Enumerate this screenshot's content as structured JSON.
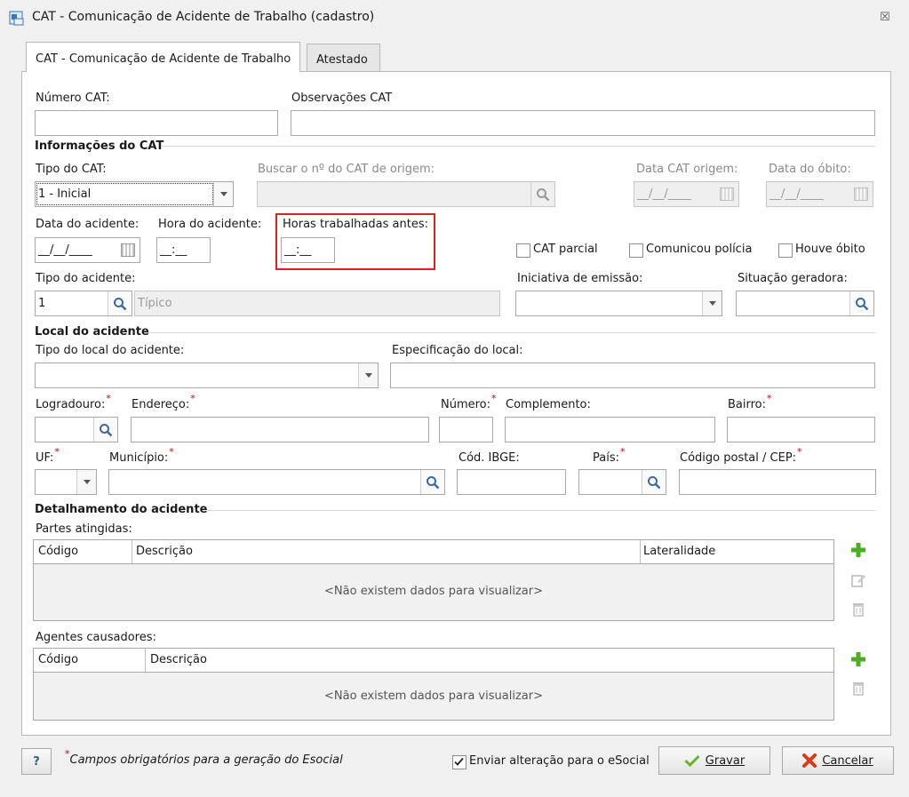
{
  "window": {
    "title": "CAT - Comunicação de Acidente de Trabalho (cadastro)",
    "close_glyph": "☒"
  },
  "tabs": [
    {
      "label": "CAT - Comunicação de Acidente de Trabalho",
      "active": true
    },
    {
      "label": "Atestado",
      "active": false
    }
  ],
  "form": {
    "numero_cat": {
      "label": "Número CAT:",
      "value": ""
    },
    "observacoes_cat": {
      "label": "Observações CAT",
      "value": ""
    },
    "section_info": "Informações do CAT",
    "tipo_cat": {
      "label": "Tipo do CAT:",
      "value": "1 - Inicial"
    },
    "buscar_cat_origem": {
      "label": "Buscar o nº do CAT de origem:",
      "value": ""
    },
    "data_cat_origem": {
      "label": "Data CAT origem:",
      "value": "__/__/____"
    },
    "data_obito": {
      "label": "Data do óbito:",
      "value": "__/__/____"
    },
    "data_acidente": {
      "label": "Data do acidente:",
      "value": "__/__/____"
    },
    "hora_acidente": {
      "label": "Hora do acidente:",
      "value": "__:__"
    },
    "horas_trabalhadas": {
      "label": "Horas trabalhadas antes:",
      "value": "__:__"
    },
    "cat_parcial": {
      "label": "CAT parcial",
      "checked": false
    },
    "comunicou_policia": {
      "label": "Comunicou polícia",
      "checked": false
    },
    "houve_obito": {
      "label": "Houve óbito",
      "checked": false
    },
    "tipo_acidente": {
      "label": "Tipo do acidente:",
      "code": "1",
      "description": "Típico"
    },
    "iniciativa_emissao": {
      "label": "Iniciativa de emissão:",
      "value": ""
    },
    "situacao_geradora": {
      "label": "Situação geradora:",
      "value": ""
    },
    "section_local": "Local do acidente",
    "tipo_local": {
      "label": "Tipo do local do acidente:",
      "value": ""
    },
    "especificacao_local": {
      "label": "Especificação do local:",
      "value": ""
    },
    "logradouro": {
      "label": "Logradouro:",
      "value": ""
    },
    "endereco": {
      "label": "Endereço:",
      "value": ""
    },
    "numero": {
      "label": "Número:",
      "value": ""
    },
    "complemento": {
      "label": "Complemento:",
      "value": ""
    },
    "bairro": {
      "label": "Bairro:",
      "value": ""
    },
    "uf": {
      "label": "UF:",
      "value": ""
    },
    "municipio": {
      "label": "Município:",
      "value": ""
    },
    "cod_ibge": {
      "label": "Cód. IBGE:",
      "value": ""
    },
    "pais": {
      "label": "País:",
      "value": ""
    },
    "cep": {
      "label": "Código postal / CEP:",
      "value": ""
    },
    "required_mark": "*",
    "section_detalhamento": "Detalhamento do acidente",
    "partes": {
      "label": "Partes atingidas:",
      "columns": [
        "Código",
        "Descrição",
        "Lateralidade"
      ],
      "empty": "<Não existem dados para visualizar>"
    },
    "agentes": {
      "label": "Agentes causadores:",
      "columns": [
        "Código",
        "Descrição"
      ],
      "empty": "<Não existem dados para visualizar>"
    }
  },
  "footer": {
    "help": "?",
    "note_mark": "*",
    "note": "Campos obrigatórios para a geração do Esocial",
    "enviar_esocial": {
      "label": "Enviar alteração para o eSocial",
      "checked": true
    },
    "gravar": "Gravar",
    "cancelar": "Cancelar"
  },
  "colors": {
    "highlight": "#e02020",
    "add_green": "#4caf20",
    "cancel_red": "#d93a1a"
  }
}
